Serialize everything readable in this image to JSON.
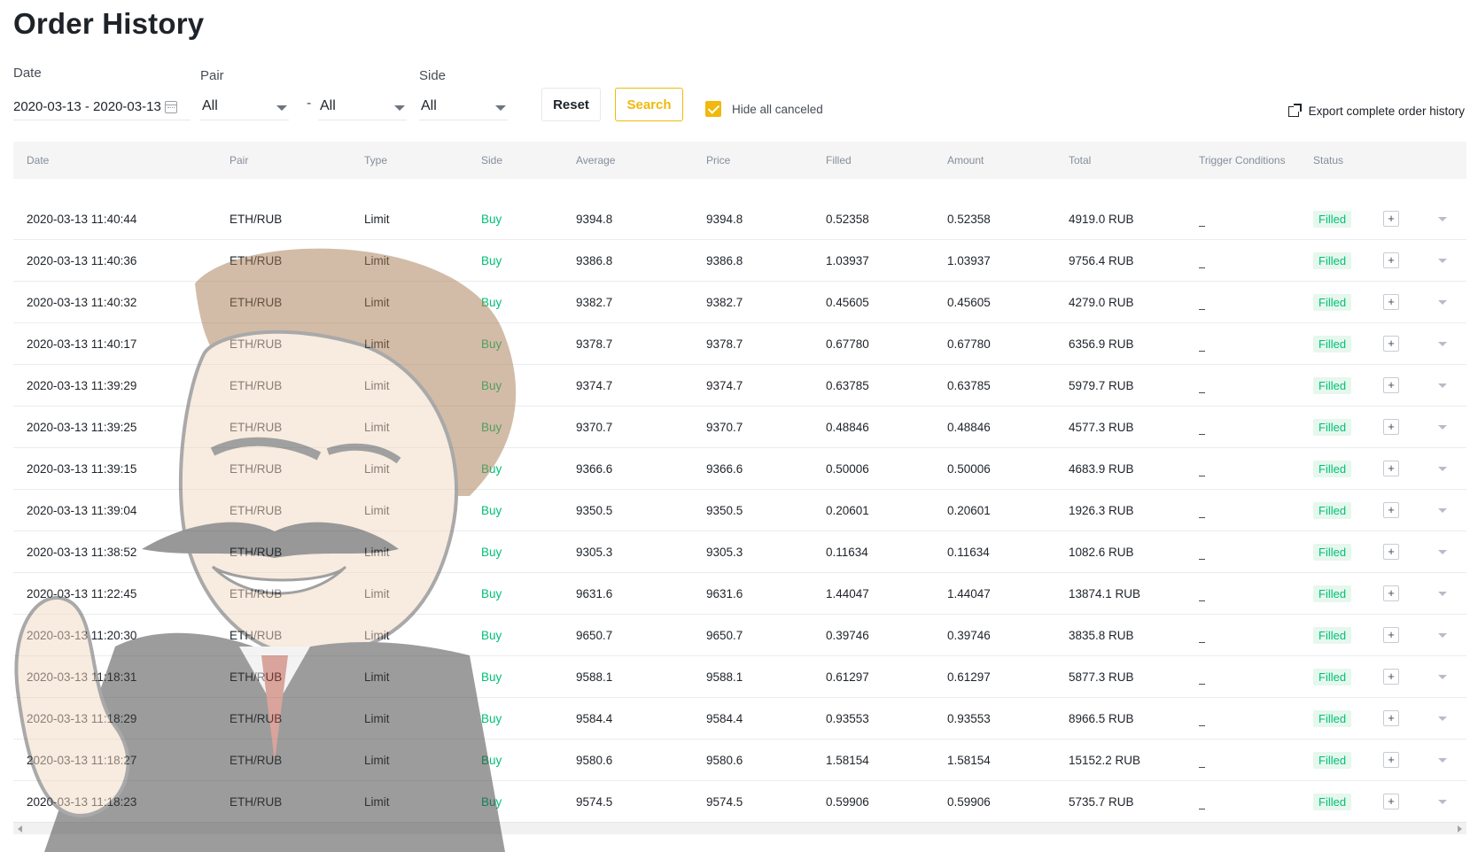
{
  "page": {
    "title": "Order History"
  },
  "filters": {
    "date_label": "Date",
    "date_range": "2020-03-13 - 2020-03-13",
    "pair_label": "Pair",
    "pair_base": "All",
    "pair_separator": "-",
    "pair_quote": "All",
    "side_label": "Side",
    "side_value": "All",
    "reset_label": "Reset",
    "search_label": "Search",
    "hide_canceled_label": "Hide all canceled",
    "hide_canceled_checked": true,
    "export_label": "Export complete order history"
  },
  "table": {
    "columns": [
      "Date",
      "Pair",
      "Type",
      "Side",
      "Average",
      "Price",
      "Filled",
      "Amount",
      "Total",
      "Trigger Conditions",
      "Status"
    ],
    "rows": [
      {
        "date": "2020-03-13 11:40:44",
        "pair": "ETH/RUB",
        "type": "Limit",
        "side": "Buy",
        "average": "9394.8",
        "price": "9394.8",
        "filled": "0.52358",
        "amount": "0.52358",
        "total": "4919.0 RUB",
        "trigger": "_",
        "status": "Filled"
      },
      {
        "date": "2020-03-13 11:40:36",
        "pair": "ETH/RUB",
        "type": "Limit",
        "side": "Buy",
        "average": "9386.8",
        "price": "9386.8",
        "filled": "1.03937",
        "amount": "1.03937",
        "total": "9756.4 RUB",
        "trigger": "_",
        "status": "Filled"
      },
      {
        "date": "2020-03-13 11:40:32",
        "pair": "ETH/RUB",
        "type": "Limit",
        "side": "Buy",
        "average": "9382.7",
        "price": "9382.7",
        "filled": "0.45605",
        "amount": "0.45605",
        "total": "4279.0 RUB",
        "trigger": "_",
        "status": "Filled"
      },
      {
        "date": "2020-03-13 11:40:17",
        "pair": "ETH/RUB",
        "type": "Limit",
        "side": "Buy",
        "average": "9378.7",
        "price": "9378.7",
        "filled": "0.67780",
        "amount": "0.67780",
        "total": "6356.9 RUB",
        "trigger": "_",
        "status": "Filled"
      },
      {
        "date": "2020-03-13 11:39:29",
        "pair": "ETH/RUB",
        "type": "Limit",
        "side": "Buy",
        "average": "9374.7",
        "price": "9374.7",
        "filled": "0.63785",
        "amount": "0.63785",
        "total": "5979.7 RUB",
        "trigger": "_",
        "status": "Filled"
      },
      {
        "date": "2020-03-13 11:39:25",
        "pair": "ETH/RUB",
        "type": "Limit",
        "side": "Buy",
        "average": "9370.7",
        "price": "9370.7",
        "filled": "0.48846",
        "amount": "0.48846",
        "total": "4577.3 RUB",
        "trigger": "_",
        "status": "Filled"
      },
      {
        "date": "2020-03-13 11:39:15",
        "pair": "ETH/RUB",
        "type": "Limit",
        "side": "Buy",
        "average": "9366.6",
        "price": "9366.6",
        "filled": "0.50006",
        "amount": "0.50006",
        "total": "4683.9 RUB",
        "trigger": "_",
        "status": "Filled"
      },
      {
        "date": "2020-03-13 11:39:04",
        "pair": "ETH/RUB",
        "type": "Limit",
        "side": "Buy",
        "average": "9350.5",
        "price": "9350.5",
        "filled": "0.20601",
        "amount": "0.20601",
        "total": "1926.3 RUB",
        "trigger": "_",
        "status": "Filled"
      },
      {
        "date": "2020-03-13 11:38:52",
        "pair": "ETH/RUB",
        "type": "Limit",
        "side": "Buy",
        "average": "9305.3",
        "price": "9305.3",
        "filled": "0.11634",
        "amount": "0.11634",
        "total": "1082.6 RUB",
        "trigger": "_",
        "status": "Filled"
      },
      {
        "date": "2020-03-13 11:22:45",
        "pair": "ETH/RUB",
        "type": "Limit",
        "side": "Buy",
        "average": "9631.6",
        "price": "9631.6",
        "filled": "1.44047",
        "amount": "1.44047",
        "total": "13874.1 RUB",
        "trigger": "_",
        "status": "Filled"
      },
      {
        "date": "2020-03-13 11:20:30",
        "pair": "ETH/RUB",
        "type": "Limit",
        "side": "Buy",
        "average": "9650.7",
        "price": "9650.7",
        "filled": "0.39746",
        "amount": "0.39746",
        "total": "3835.8 RUB",
        "trigger": "_",
        "status": "Filled"
      },
      {
        "date": "2020-03-13 11:18:31",
        "pair": "ETH/RUB",
        "type": "Limit",
        "side": "Buy",
        "average": "9588.1",
        "price": "9588.1",
        "filled": "0.61297",
        "amount": "0.61297",
        "total": "5877.3 RUB",
        "trigger": "_",
        "status": "Filled"
      },
      {
        "date": "2020-03-13 11:18:29",
        "pair": "ETH/RUB",
        "type": "Limit",
        "side": "Buy",
        "average": "9584.4",
        "price": "9584.4",
        "filled": "0.93553",
        "amount": "0.93553",
        "total": "8966.5 RUB",
        "trigger": "_",
        "status": "Filled"
      },
      {
        "date": "2020-03-13 11:18:27",
        "pair": "ETH/RUB",
        "type": "Limit",
        "side": "Buy",
        "average": "9580.6",
        "price": "9580.6",
        "filled": "1.58154",
        "amount": "1.58154",
        "total": "15152.2 RUB",
        "trigger": "_",
        "status": "Filled"
      },
      {
        "date": "2020-03-13 11:18:23",
        "pair": "ETH/RUB",
        "type": "Limit",
        "side": "Buy",
        "average": "9574.5",
        "price": "9574.5",
        "filled": "0.59906",
        "amount": "0.59906",
        "total": "5735.7 RUB",
        "trigger": "_",
        "status": "Filled"
      }
    ]
  },
  "colors": {
    "accent": "#f0b90b",
    "buy": "#02c076",
    "status_filled_bg": "#e6f7ee"
  },
  "icons": {
    "calendar": "calendar-icon",
    "export": "external-link-icon",
    "expand_row": "plus-icon",
    "row_toggle": "chevron-down-icon"
  }
}
